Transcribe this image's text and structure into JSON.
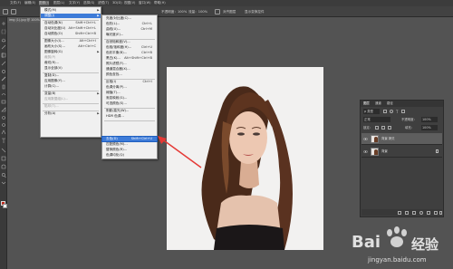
{
  "menubar": {
    "items": [
      "文件(F)",
      "编辑(E)",
      "图像(I)",
      "图层(L)",
      "文字(Y)",
      "选择(S)",
      "滤镜(T)",
      "3D(D)",
      "视图(V)",
      "窗口(W)",
      "帮助(H)"
    ]
  },
  "optbar": {
    "text1": "不透明度：100%",
    "text2": "流量：100%",
    "text3": "对齐图层",
    "text4": "显示变换控件"
  },
  "doc_tab": "img (1).jpg @ 100%",
  "image_menu": {
    "items": [
      {
        "label": "模式(M)",
        "shortcut": "",
        "arrow": true
      },
      {
        "label": "调整(J)",
        "shortcut": "",
        "arrow": true,
        "highlight": true
      },
      {
        "label": "自动色调(N)",
        "shortcut": "Shift+Ctrl+L"
      },
      {
        "label": "自动对比度(U)",
        "shortcut": "Alt+Shift+Ctrl+L"
      },
      {
        "label": "自动颜色(O)",
        "shortcut": "Shift+Ctrl+B"
      },
      {
        "label": "图像大小(I)...",
        "shortcut": "Alt+Ctrl+I"
      },
      {
        "label": "画布大小(S)...",
        "shortcut": "Alt+Ctrl+C"
      },
      {
        "label": "图像旋转(G)",
        "shortcut": "",
        "arrow": true
      },
      {
        "label": "裁剪(P)",
        "shortcut": "",
        "disabled": true
      },
      {
        "label": "裁切(R)...",
        "shortcut": ""
      },
      {
        "label": "显示全部(V)",
        "shortcut": ""
      },
      {
        "label": "复制(D)...",
        "shortcut": ""
      },
      {
        "label": "应用图像(Y)...",
        "shortcut": ""
      },
      {
        "label": "计算(C)...",
        "shortcut": ""
      },
      {
        "label": "变量(B)",
        "shortcut": "",
        "arrow": true
      },
      {
        "label": "应用数据组(L)...",
        "shortcut": "",
        "disabled": true
      },
      {
        "label": "陷印(T)...",
        "shortcut": "",
        "disabled": true
      },
      {
        "label": "分析(A)",
        "shortcut": "",
        "arrow": true
      }
    ]
  },
  "adjust_menu": {
    "items": [
      {
        "label": "亮度/对比度(C)...",
        "shortcut": ""
      },
      {
        "label": "色阶(L)...",
        "shortcut": "Ctrl+L"
      },
      {
        "label": "曲线(U)...",
        "shortcut": "Ctrl+M"
      },
      {
        "label": "曝光度(E)...",
        "shortcut": ""
      },
      {
        "label": "自然饱和度(V)...",
        "shortcut": ""
      },
      {
        "label": "色相/饱和度(H)...",
        "shortcut": "Ctrl+U"
      },
      {
        "label": "色彩平衡(B)...",
        "shortcut": "Ctrl+B"
      },
      {
        "label": "黑白(K)...",
        "shortcut": "Alt+Shift+Ctrl+B"
      },
      {
        "label": "照片滤镜(F)...",
        "shortcut": ""
      },
      {
        "label": "通道混合器(X)...",
        "shortcut": ""
      },
      {
        "label": "颜色查找...",
        "shortcut": ""
      },
      {
        "label": "反相(I)",
        "shortcut": "Ctrl+I"
      },
      {
        "label": "色调分离(P)...",
        "shortcut": ""
      },
      {
        "label": "阈值(T)...",
        "shortcut": ""
      },
      {
        "label": "渐变映射(G)...",
        "shortcut": ""
      },
      {
        "label": "可选颜色(S)...",
        "shortcut": ""
      },
      {
        "label": "阴影/高光(W)...",
        "shortcut": ""
      },
      {
        "label": "HDR 色调...",
        "shortcut": ""
      },
      {
        "label": "去色(D)",
        "shortcut": "Shift+Ctrl+U",
        "highlight": true
      },
      {
        "label": "匹配颜色(M)...",
        "shortcut": ""
      },
      {
        "label": "替换颜色(R)...",
        "shortcut": ""
      },
      {
        "label": "色调均化(Q)",
        "shortcut": ""
      }
    ]
  },
  "layers_panel": {
    "tabs": [
      "图层",
      "通道",
      "路径"
    ],
    "kind_label": "ρ 类型",
    "blend_mode": "正常",
    "opacity_label": "不透明度：",
    "opacity_value": "100%",
    "lock_label": "锁定：",
    "fill_label": "填充：",
    "fill_value": "100%",
    "layers": [
      {
        "name": "背景 拷贝",
        "selected": true
      },
      {
        "name": "背景",
        "selected": false
      }
    ]
  },
  "watermark": {
    "brand": "Bai",
    "brand2": "经验",
    "url": "jingyan.baidu.com"
  },
  "colors": {
    "accent": "#3d7bd8",
    "arrow": "#e53935",
    "foreground": "#c22a1d"
  }
}
